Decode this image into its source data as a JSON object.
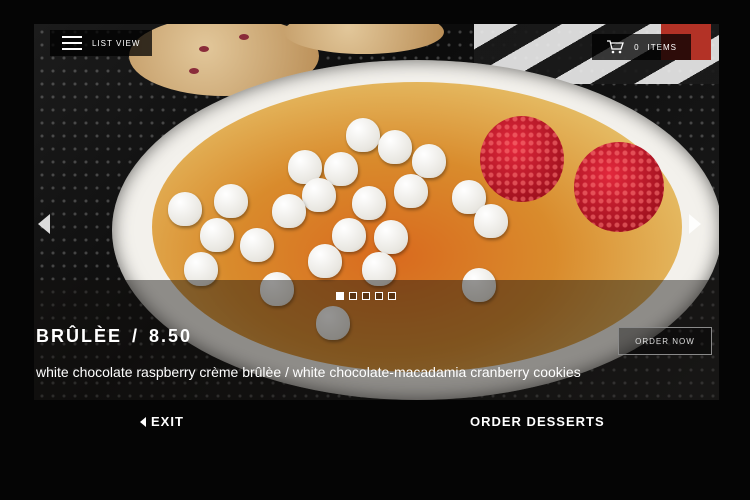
{
  "header": {
    "list_view_label": "LIST VIEW",
    "cart_count": "0",
    "cart_label": "ITEMS"
  },
  "item": {
    "name": "BRÛLÈE",
    "separator": "/",
    "price": "8.50",
    "description": "white chocolate raspberry crème brûlèe / white chocolate-macadamia cranberry cookies",
    "order_now_label": "ORDER NOW"
  },
  "carousel": {
    "slide_count": 5,
    "active_index": 0
  },
  "footer": {
    "exit_label": "EXIT",
    "order_desserts_label": "ORDER DESSERTS"
  },
  "icons": {
    "menu": "hamburger-icon",
    "cart": "cart-icon",
    "prev": "chevron-left-icon",
    "next": "chevron-right-icon",
    "exit": "back-arrow-icon"
  },
  "colors": {
    "background": "#050505",
    "text": "#ffffff",
    "accent_red": "#b33226"
  }
}
